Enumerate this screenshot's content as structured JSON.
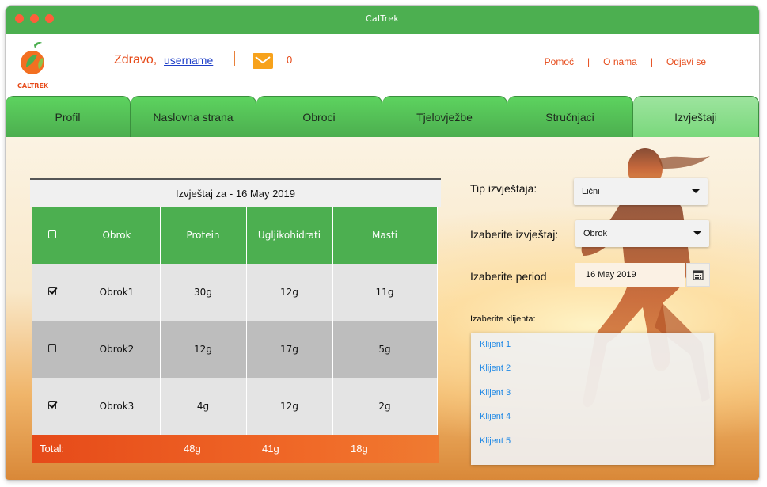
{
  "window": {
    "title": "CalTrek"
  },
  "header": {
    "logo_text": "CALTREK",
    "greeting": "Zdravo,",
    "username": "username",
    "message_count": "0",
    "links": [
      "Pomoć",
      "O nama",
      "Odjavi se"
    ]
  },
  "tabs": [
    "Profil",
    "Naslovna strana",
    "Obroci",
    "Tjelovježbe",
    "Stručnjaci",
    "Izvještaji"
  ],
  "active_tab": "Izvještaji",
  "report": {
    "title": "Izvještaj za - 16 May 2019",
    "columns": [
      "Obrok",
      "Protein",
      "Ugljikohidrati",
      "Masti"
    ],
    "rows": [
      {
        "checked": true,
        "meal": "Obrok1",
        "protein": "30g",
        "carbs": "12g",
        "fat": "11g"
      },
      {
        "checked": false,
        "meal": "Obrok2",
        "protein": "12g",
        "carbs": "17g",
        "fat": "5g"
      },
      {
        "checked": true,
        "meal": "Obrok3",
        "protein": "4g",
        "carbs": "12g",
        "fat": "2g"
      }
    ],
    "total_label": "Total:",
    "total_protein": "48g",
    "total_carbs": "41g",
    "total_fat": "18g"
  },
  "filters": {
    "type_label": "Tip izvještaja:",
    "type_value": "Lični",
    "report_label": "Izaberite izvještaj:",
    "report_value": "Obrok",
    "period_label": "Izaberite period",
    "period_value": "16 May 2019",
    "clients_label": "Izaberite klijenta:",
    "clients": [
      "Klijent 1",
      "Klijent 2",
      "Klijent 3",
      "Klijent 4",
      "Klijent 5"
    ]
  },
  "colors": {
    "brand_green": "#4caf50",
    "accent_orange": "#e64a19",
    "link_blue": "#1e88e5"
  }
}
